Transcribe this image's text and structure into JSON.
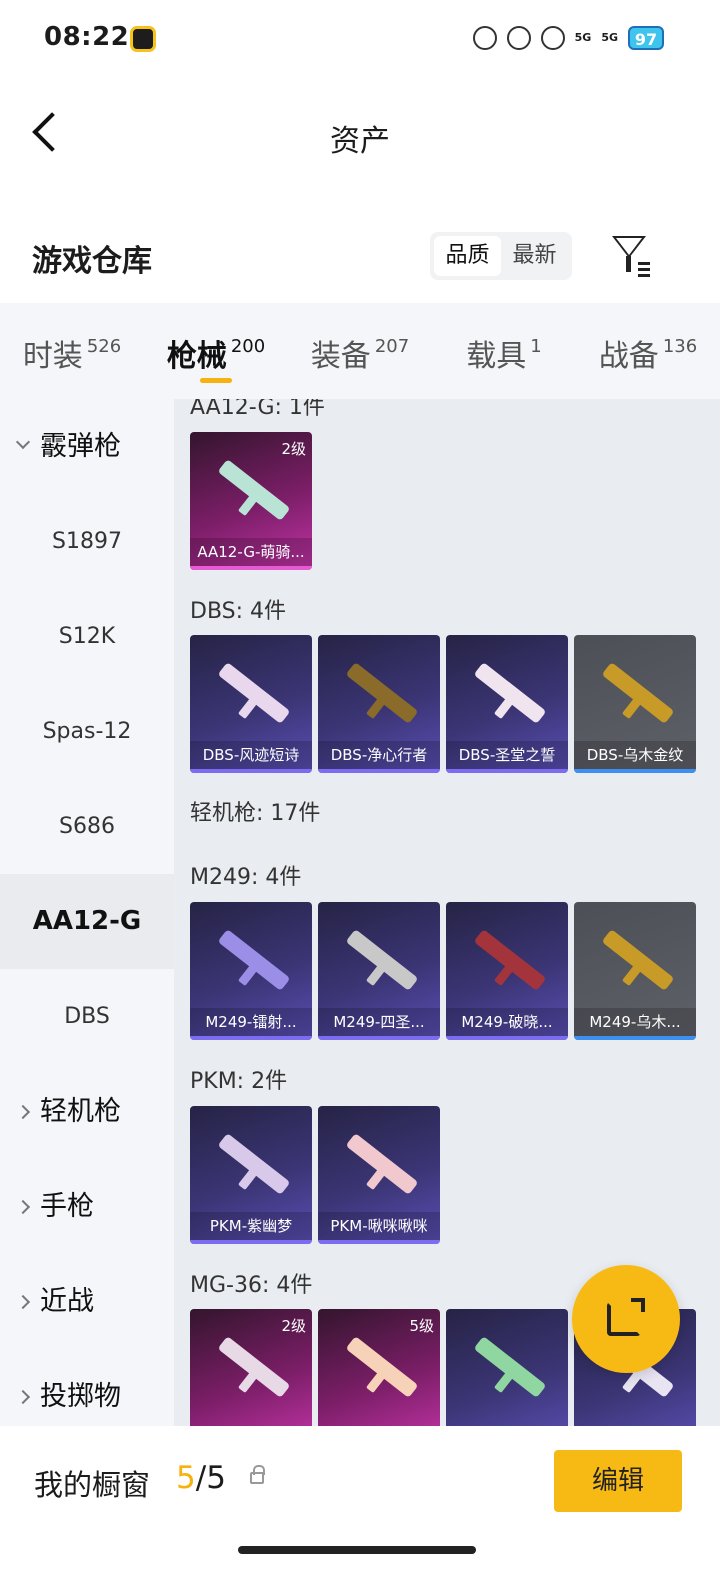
{
  "status_bar": {
    "time": "08:22",
    "network": "5G",
    "battery": "97"
  },
  "header": {
    "title": "资产"
  },
  "warehouse": {
    "title": "游戏仓库",
    "sort_options": [
      "品质",
      "最新"
    ],
    "sort_active": "品质"
  },
  "tabs": [
    {
      "label": "时装",
      "count": "526"
    },
    {
      "label": "枪械",
      "count": "200"
    },
    {
      "label": "装备",
      "count": "207"
    },
    {
      "label": "载具",
      "count": "1"
    },
    {
      "label": "战备",
      "count": "136"
    }
  ],
  "sidebar": {
    "shotgun": "霰弹枪",
    "items": [
      "S1897",
      "S12K",
      "Spas-12",
      "S686",
      "AA12-G",
      "DBS"
    ],
    "selected": "AA12-G",
    "lmg": "轻机枪",
    "pistol": "手枪",
    "melee": "近战",
    "throwable": "投掷物"
  },
  "groups": {
    "aa12": {
      "label": "AA12-G: 1件",
      "cards": [
        {
          "name": "AA12-G-萌骑...",
          "level": "2级",
          "rarity": "legendary"
        }
      ]
    },
    "dbs": {
      "label": "DBS: 4件",
      "cards": [
        {
          "name": "DBS-风迹短诗",
          "rarity": "epic"
        },
        {
          "name": "DBS-净心行者",
          "rarity": "epic"
        },
        {
          "name": "DBS-圣堂之誓",
          "rarity": "epic"
        },
        {
          "name": "DBS-乌木金纹",
          "rarity": "rare"
        }
      ]
    },
    "lmg_total": {
      "label": "轻机枪: 17件"
    },
    "m249": {
      "label": "M249: 4件",
      "cards": [
        {
          "name": "M249-镭射...",
          "rarity": "epic"
        },
        {
          "name": "M249-四圣...",
          "rarity": "epic"
        },
        {
          "name": "M249-破晓...",
          "rarity": "epic"
        },
        {
          "name": "M249-乌木...",
          "rarity": "rare"
        }
      ]
    },
    "pkm": {
      "label": "PKM: 2件",
      "cards": [
        {
          "name": "PKM-紫幽梦",
          "rarity": "epic"
        },
        {
          "name": "PKM-啾咪啾咪",
          "rarity": "epic"
        }
      ]
    },
    "mg36": {
      "label": "MG-36: 4件",
      "cards": [
        {
          "level": "2级",
          "rarity": "legendary"
        },
        {
          "level": "5级",
          "rarity": "legendary"
        },
        {
          "rarity": "epic"
        },
        {
          "rarity": "epic"
        }
      ]
    }
  },
  "bottom": {
    "showcase_label": "我的橱窗",
    "used": "5",
    "separator": "/",
    "total": "5",
    "edit_label": "编辑"
  },
  "colors": {
    "accent": "#f6b20e",
    "legendary": "#c234a7",
    "epic": "#5a4fb4",
    "rare": "#5f6169"
  }
}
